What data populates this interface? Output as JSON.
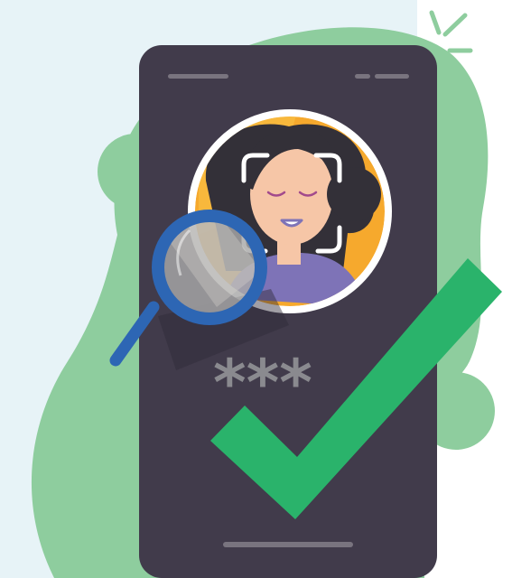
{
  "illustration": {
    "subject": "face-recognition-login",
    "password_mask": "***",
    "colors": {
      "panel_bg": "#e7f3f7",
      "blob_green": "#8ecd9e",
      "phone_body": "#413b4b",
      "phone_bar": "#79747f",
      "avatar_ring": "#ffffff",
      "avatar_bg": "#f6a92d",
      "hair": "#333038",
      "skin": "#f6c6a7",
      "shirt": "#7e73b7",
      "lens_ring": "#2d66b4",
      "lens_glass": "#a8a8a8",
      "checkmark": "#2ab36b",
      "mask_text": "#8a8a8f"
    },
    "icons": [
      "magnifier-icon",
      "checkmark-icon",
      "face-scan-frame-icon",
      "sparkle-icon"
    ]
  }
}
